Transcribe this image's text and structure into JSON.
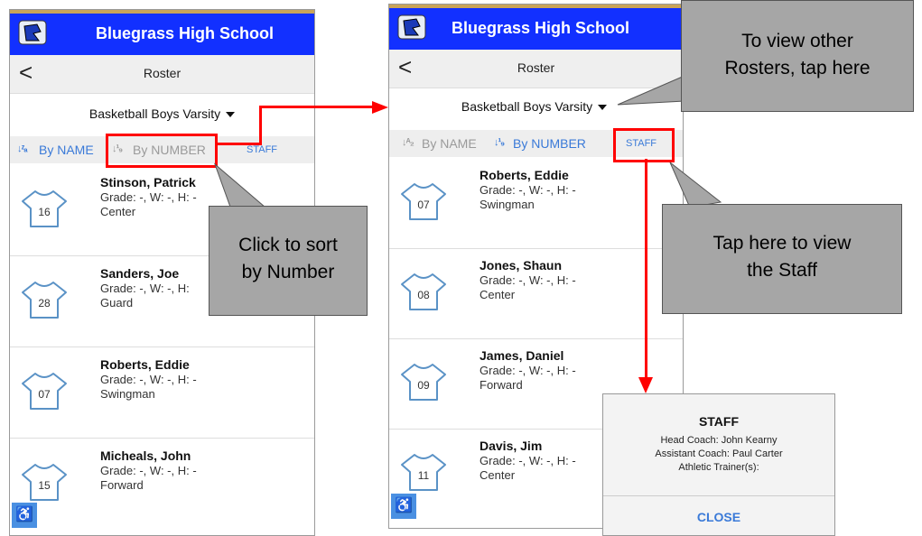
{
  "screen1": {
    "school": "Bluegrass High School",
    "nav_title": "Roster",
    "back": "<",
    "team": "Basketball Boys Varsity",
    "sort_name_icon": "↓ᶻₐ",
    "sort_name": "By NAME",
    "sort_number_icon": "↓¹₉",
    "sort_number": "By NUMBER",
    "staff": "STAFF",
    "players": [
      {
        "name": "Stinson, Patrick",
        "info": "Grade: -, W: -, H: -",
        "position": "Center",
        "number": "16"
      },
      {
        "name": "Sanders, Joe",
        "info": "Grade: -, W: -, H:",
        "position": "Guard",
        "number": "28"
      },
      {
        "name": "Roberts, Eddie",
        "info": "Grade: -, W: -, H: -",
        "position": "Swingman",
        "number": "07"
      },
      {
        "name": "Micheals, John",
        "info": "Grade: -, W: -, H: -",
        "position": "Forward",
        "number": "15"
      }
    ],
    "fab": "♿"
  },
  "screen2": {
    "school": "Bluegrass High School",
    "nav_title": "Roster",
    "back": "<",
    "team": "Basketball Boys Varsity",
    "sort_name_icon": "↓ᴬ₂",
    "sort_name": "By NAME",
    "sort_number_icon": "↓¹₉",
    "sort_number": "By NUMBER",
    "staff": "STAFF",
    "players": [
      {
        "name": "Roberts, Eddie",
        "info": "Grade: -, W: -, H: -",
        "position": "Swingman",
        "number": "07"
      },
      {
        "name": "Jones, Shaun",
        "info": "Grade: -, W: -, H: -",
        "position": "Center",
        "number": "08"
      },
      {
        "name": "James, Daniel",
        "info": "Grade: -, W: -, H: -",
        "position": "Forward",
        "number": "09"
      },
      {
        "name": "Davis, Jim",
        "info": "Grade: -, W: -, H: -",
        "position": "Center",
        "number": "11"
      }
    ],
    "fab": "♿"
  },
  "callouts": {
    "sort_number": [
      "Click to sort",
      "by Number"
    ],
    "other_rosters": [
      "To view other",
      "Rosters, tap here"
    ],
    "staff": [
      "Tap here to view",
      "the Staff"
    ]
  },
  "staff_popup": {
    "title": "STAFF",
    "head_coach": "Head Coach: John Kearny",
    "assistant_coach": "Assistant Coach: Paul Carter",
    "trainer": "Athletic Trainer(s):",
    "close": "CLOSE"
  },
  "colors": {
    "header": "#1230ff",
    "accent": "#3a7ad8",
    "annotation": "#ff0000",
    "callout": "#a6a6a6"
  },
  "icons": {
    "logo": "school-logo-icon",
    "jersey": "jersey-icon",
    "accessibility": "accessibility-icon",
    "dropdown": "dropdown-triangle-icon"
  }
}
